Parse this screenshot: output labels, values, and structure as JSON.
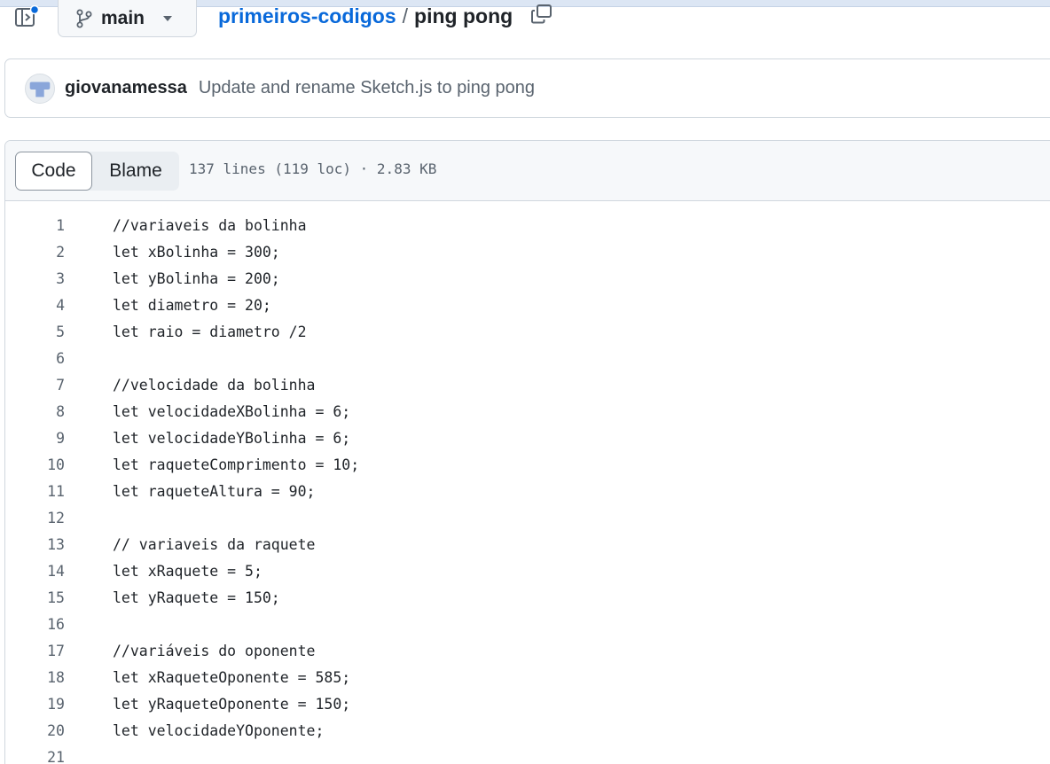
{
  "header": {
    "branch": {
      "label": "main",
      "icon": "git-branch-icon"
    },
    "breadcrumb": {
      "repo": "primeiros-codigos",
      "separator": "/",
      "file": "ping pong"
    }
  },
  "commit": {
    "author": "giovanamessa",
    "message": "Update and rename Sketch.js to ping pong"
  },
  "file": {
    "tabs": {
      "code": "Code",
      "blame": "Blame"
    },
    "info": "137 lines (119 loc) · 2.83 KB",
    "lines": [
      {
        "num": "1",
        "text": "//variaveis da bolinha"
      },
      {
        "num": "2",
        "text": "let xBolinha = 300;"
      },
      {
        "num": "3",
        "text": "let yBolinha = 200;"
      },
      {
        "num": "4",
        "text": "let diametro = 20;"
      },
      {
        "num": "5",
        "text": "let raio = diametro /2"
      },
      {
        "num": "6",
        "text": ""
      },
      {
        "num": "7",
        "text": "//velocidade da bolinha"
      },
      {
        "num": "8",
        "text": "let velocidadeXBolinha = 6;"
      },
      {
        "num": "9",
        "text": "let velocidadeYBolinha = 6;"
      },
      {
        "num": "10",
        "text": "let raqueteComprimento = 10;"
      },
      {
        "num": "11",
        "text": "let raqueteAltura = 90;"
      },
      {
        "num": "12",
        "text": ""
      },
      {
        "num": "13",
        "text": "// variaveis da raquete"
      },
      {
        "num": "14",
        "text": "let xRaquete = 5;"
      },
      {
        "num": "15",
        "text": "let yRaquete = 150;"
      },
      {
        "num": "16",
        "text": ""
      },
      {
        "num": "17",
        "text": "//variáveis do oponente"
      },
      {
        "num": "18",
        "text": "let xRaqueteOponente = 585;"
      },
      {
        "num": "19",
        "text": "let yRaqueteOponente = 150;"
      },
      {
        "num": "20",
        "text": "let velocidadeYOponente;"
      },
      {
        "num": "21",
        "text": ""
      }
    ]
  },
  "colors": {
    "link": "#0969da",
    "muted": "#59636e",
    "border": "#d0d7de",
    "notification_dot": "#0969da"
  }
}
